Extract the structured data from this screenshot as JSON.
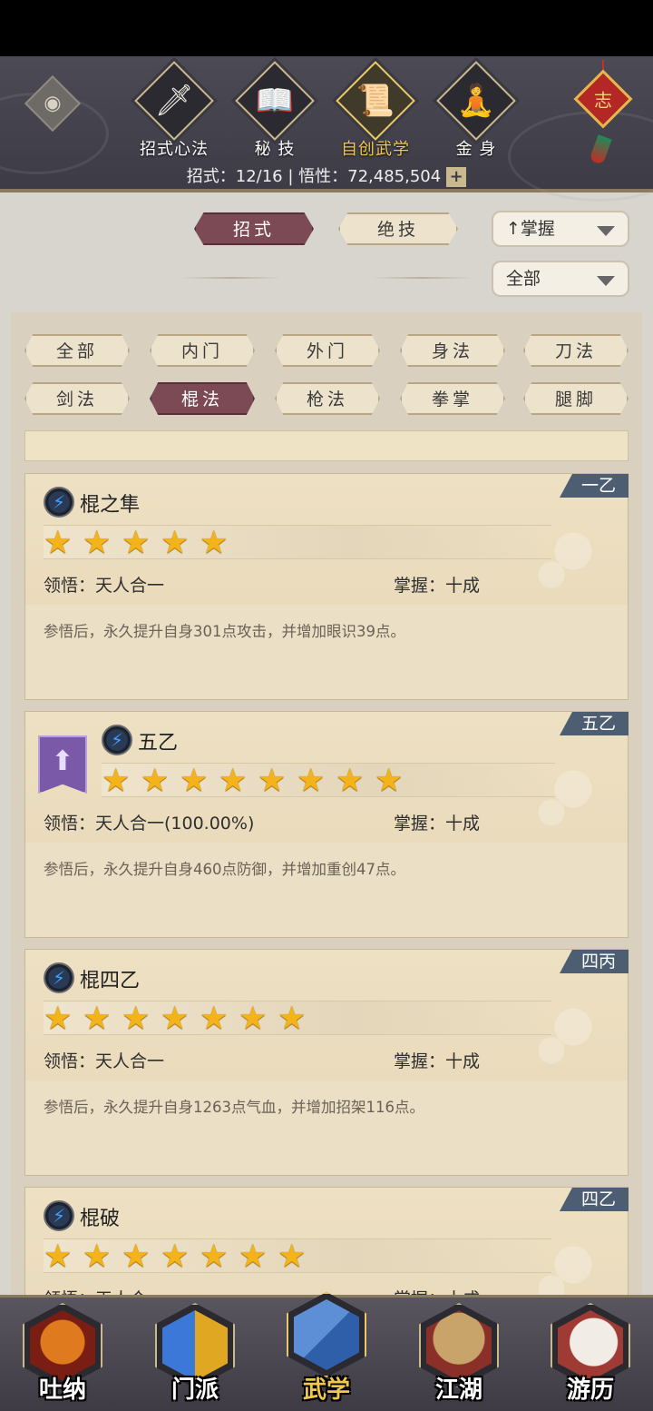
{
  "header": {
    "tabs": [
      {
        "label": "招式心法",
        "icon": "sword-icon",
        "glyph": "🗡"
      },
      {
        "label": "秘 技",
        "icon": "book-icon",
        "glyph": "📖"
      },
      {
        "label": "自创武学",
        "icon": "scroll-icon",
        "glyph": "📜"
      },
      {
        "label": "金 身",
        "icon": "meditation-icon",
        "glyph": "🧘"
      }
    ],
    "active_tab": 2,
    "knot_char": "志",
    "stats_text": "招式：12/16 | 悟性：72,485,504",
    "plus": "+"
  },
  "subtabs": {
    "moves": "招式",
    "ultimate": "绝技"
  },
  "sort_select": "↑掌握",
  "filter_select": "全部",
  "filters": [
    "全部",
    "内门",
    "外门",
    "身法",
    "刀法",
    "剑法",
    "棍法",
    "枪法",
    "拳掌",
    "腿脚"
  ],
  "active_filter": 6,
  "cards": [
    {
      "name": "棍之隼",
      "tag": "一乙",
      "stars": 5,
      "comprehend": "领悟：天人合一",
      "mastery": "掌握：十成",
      "desc": "参悟后，永久提升自身301点攻击，并增加眼识39点。",
      "upgrade": false
    },
    {
      "name": "五乙",
      "tag": "五乙",
      "stars": 8,
      "comprehend": "领悟：天人合一(100.00%)",
      "mastery": "掌握：十成",
      "desc": "参悟后，永久提升自身460点防御，并增加重创47点。",
      "upgrade": true
    },
    {
      "name": "棍四乙",
      "tag": "四丙",
      "stars": 7,
      "comprehend": "领悟：天人合一",
      "mastery": "掌握：十成",
      "desc": "参悟后，永久提升自身1263点气血，并增加招架116点。",
      "upgrade": false
    },
    {
      "name": "棍破",
      "tag": "四乙",
      "stars": 7,
      "comprehend": "领悟：天人合一",
      "mastery": "掌握：十成",
      "desc": "",
      "upgrade": false
    }
  ],
  "bottom_nav": [
    {
      "label": "吐纳",
      "icon": "monk-icon"
    },
    {
      "label": "门派",
      "icon": "flags-icon"
    },
    {
      "label": "武学",
      "icon": "books-icon"
    },
    {
      "label": "江湖",
      "icon": "straw-hat-icon"
    },
    {
      "label": "游历",
      "icon": "horse-icon"
    }
  ],
  "active_nav": 2,
  "colors": {
    "accent": "#7b4a55",
    "gold": "#f1c84e",
    "header": "#45434d",
    "tag": "#4d5e73"
  }
}
